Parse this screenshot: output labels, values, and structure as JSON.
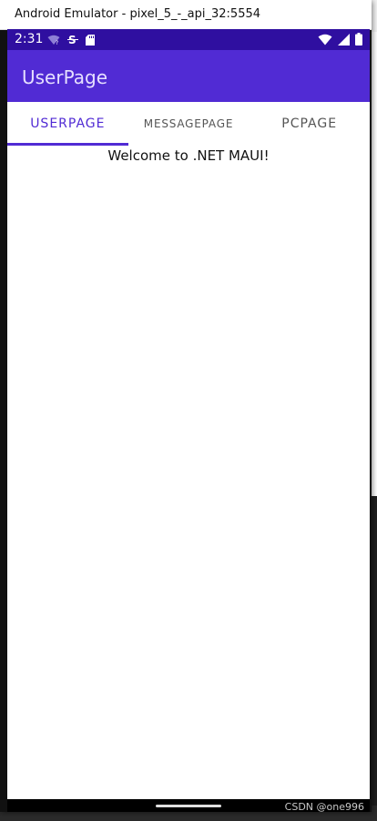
{
  "window": {
    "title": "Android Emulator - pixel_5_-_api_32:5554"
  },
  "statusbar": {
    "time": "2:31",
    "bg_color": "#2f0fa0",
    "left_icons": [
      "wifi-question-icon",
      "sim-s-icon",
      "sd-card-icon"
    ],
    "right_icons": [
      "wifi-icon",
      "signal-icon",
      "battery-icon"
    ]
  },
  "appbar": {
    "title": "UserPage",
    "bg_color": "#512bd4"
  },
  "tabs": [
    {
      "label": "USERPAGE",
      "active": true
    },
    {
      "label": "MESSAGEPAGE",
      "active": false
    },
    {
      "label": "PCPAGE",
      "active": false
    }
  ],
  "content": {
    "welcome_text": "Welcome to .NET MAUI!"
  },
  "watermark": "CSDN @one996"
}
